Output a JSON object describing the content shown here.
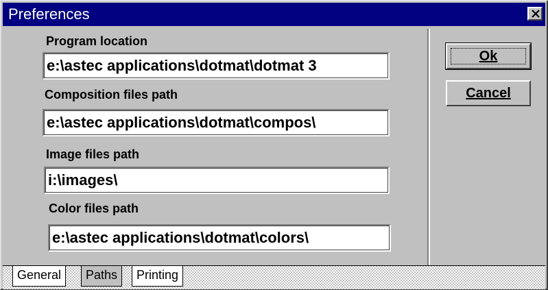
{
  "window": {
    "title": "Preferences",
    "close_label": "×"
  },
  "fields": [
    {
      "label": "Program location",
      "value": "e:\\astec applications\\dotmat\\dotmat 3"
    },
    {
      "label": "Composition files path",
      "value": "e:\\astec applications\\dotmat\\compos\\"
    },
    {
      "label": "Image files path",
      "value": "i:\\images\\"
    },
    {
      "label": "Color files path",
      "value": "e:\\astec applications\\dotmat\\colors\\"
    }
  ],
  "buttons": {
    "ok_label": "Ok",
    "cancel_label": "Cancel"
  },
  "tabs": [
    {
      "label": "General"
    },
    {
      "label": "Paths",
      "active": true
    },
    {
      "label": "Printing"
    }
  ],
  "colors": {
    "titlebar": "#000080",
    "face": "#c0c0c0"
  }
}
